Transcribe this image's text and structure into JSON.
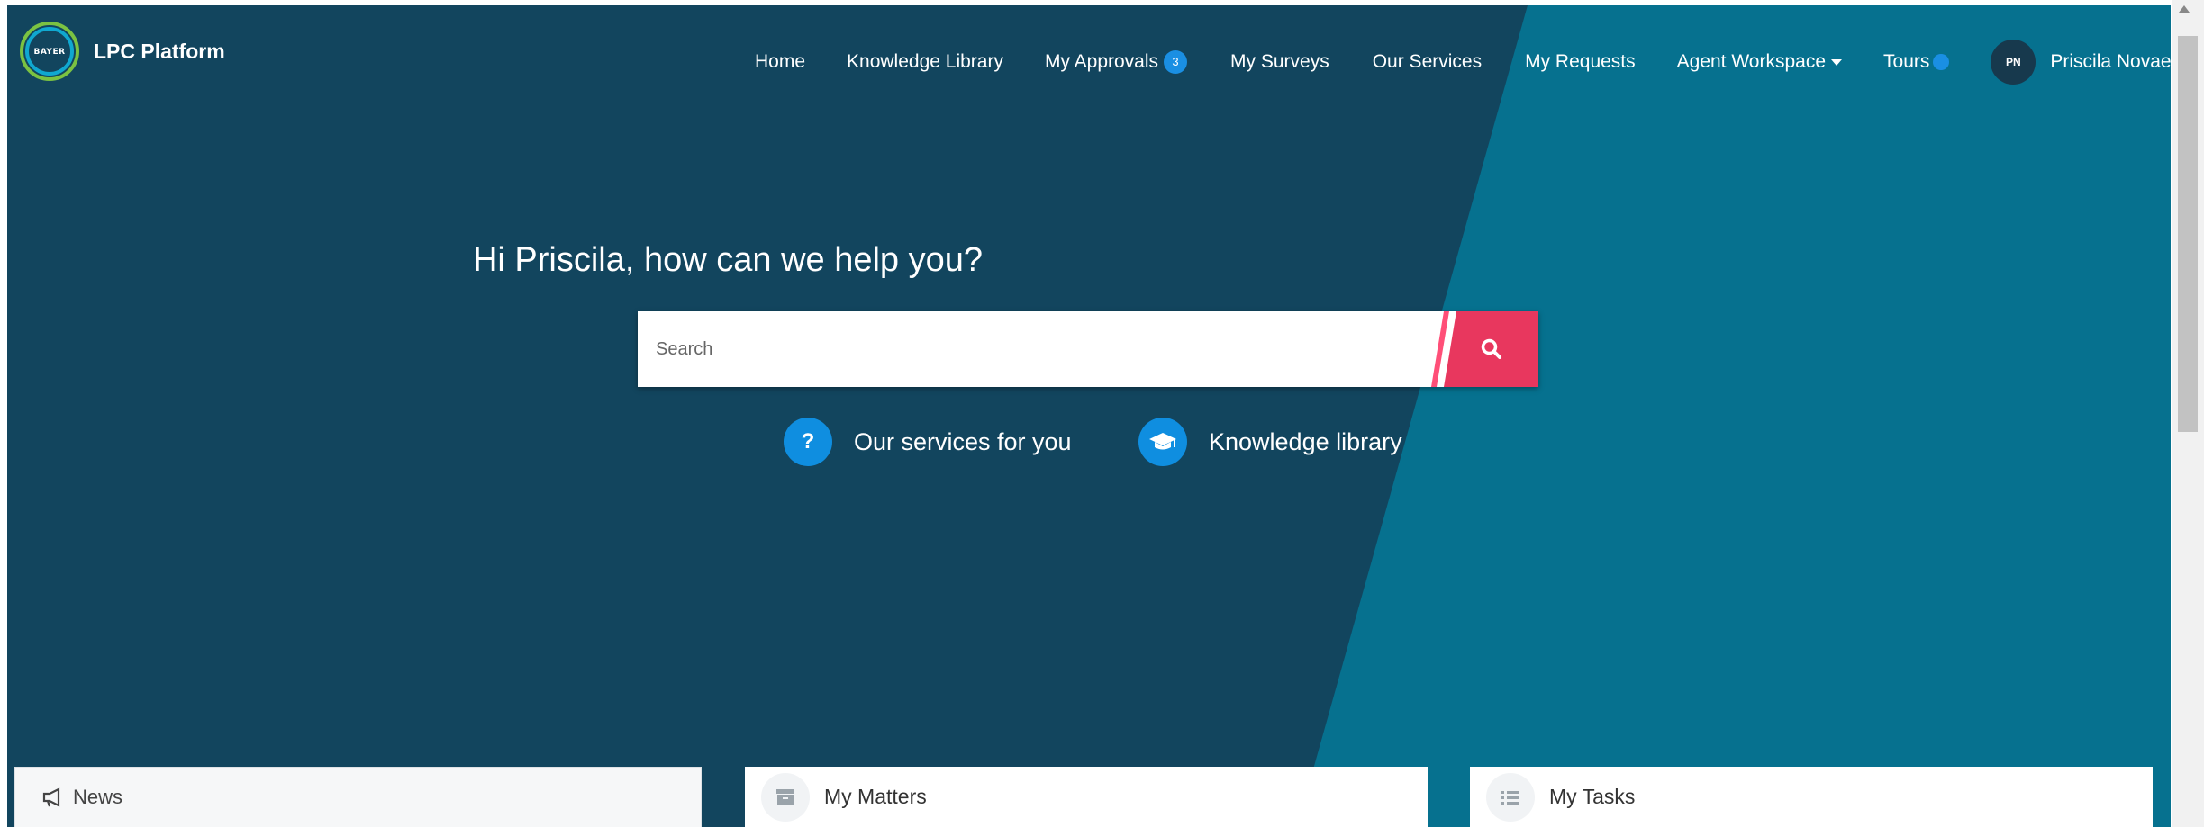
{
  "header": {
    "logo_text": "BAYER",
    "app_name": "LPC Platform"
  },
  "nav": {
    "home": "Home",
    "knowledge_library": "Knowledge Library",
    "my_approvals": "My Approvals",
    "approvals_badge": "3",
    "my_surveys": "My Surveys",
    "our_services": "Our Services",
    "my_requests": "My Requests",
    "agent_workspace": "Agent Workspace",
    "tours": "Tours",
    "user_initials": "PN",
    "user_name": "Priscila Novaes"
  },
  "hero": {
    "greeting": "Hi Priscila, how can we help you?",
    "search_placeholder": "Search"
  },
  "quick_links": {
    "services_label": "Our services for you",
    "services_icon": "question-icon",
    "knowledge_label": "Knowledge library",
    "knowledge_icon": "graduation-cap-icon"
  },
  "cards": {
    "news": "News",
    "matters": "My Matters",
    "tasks": "My Tasks"
  },
  "colors": {
    "hero_dark": "#12455e",
    "hero_teal": "#06718f",
    "accent_pink": "#e8375e",
    "badge_blue": "#1a8fe3"
  }
}
